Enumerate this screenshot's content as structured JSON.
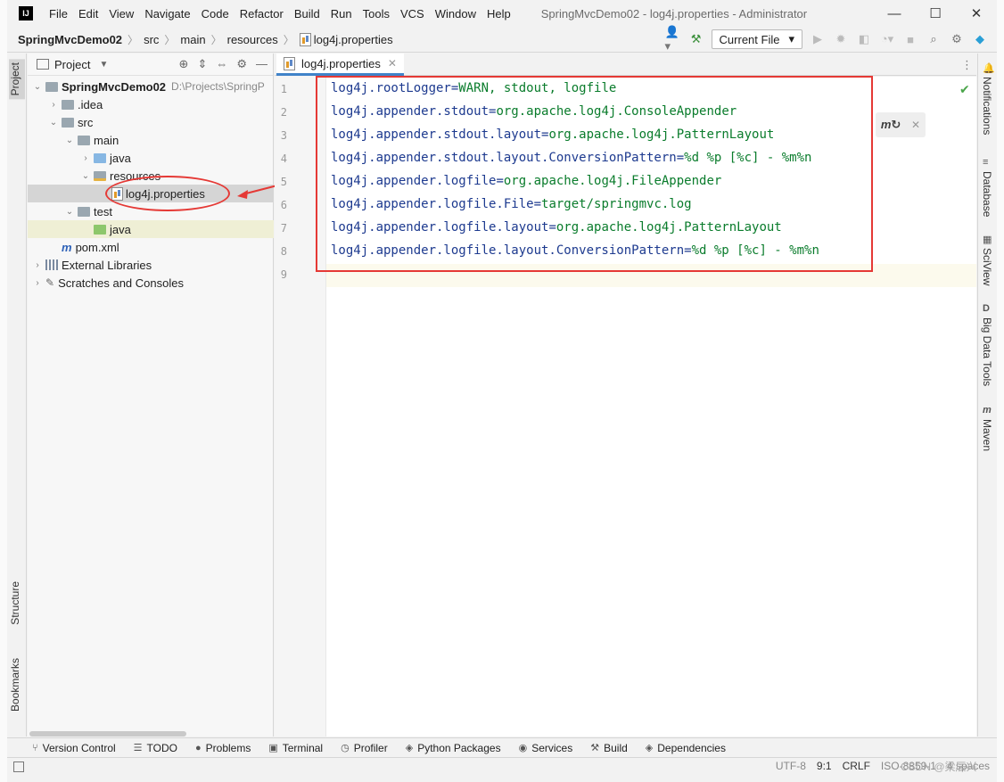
{
  "window": {
    "title": "SpringMvcDemo02 - log4j.properties - Administrator",
    "app_logo": "IJ",
    "controls": [
      "—",
      "☐",
      "✕"
    ]
  },
  "menu": [
    "File",
    "Edit",
    "View",
    "Navigate",
    "Code",
    "Refactor",
    "Build",
    "Run",
    "Tools",
    "VCS",
    "Window",
    "Help"
  ],
  "breadcrumb": {
    "items": [
      "SpringMvcDemo02",
      "src",
      "main",
      "resources",
      "log4j.properties"
    ]
  },
  "toolbar": {
    "run_config": "Current File"
  },
  "left_stripe": {
    "project_tab": "Project",
    "structure_tab": "Structure",
    "bookmarks_tab": "Bookmarks"
  },
  "project_panel": {
    "title": "Project",
    "tree": [
      {
        "label": "SpringMvcDemo02",
        "hint": "D:\\Projects\\SpringP",
        "icon": "folder"
      },
      {
        "label": ".idea",
        "icon": "folder"
      },
      {
        "label": "src",
        "icon": "folder"
      },
      {
        "label": "main",
        "icon": "folder"
      },
      {
        "label": "java",
        "icon": "folder-blue"
      },
      {
        "label": "resources",
        "icon": "folder-resources"
      },
      {
        "label": "log4j.properties",
        "icon": "properties-file"
      },
      {
        "label": "test",
        "icon": "folder"
      },
      {
        "label": "java",
        "icon": "folder-green"
      },
      {
        "label": "pom.xml",
        "icon": "maven-icon"
      },
      {
        "label": "External Libraries",
        "icon": "libraries-icon"
      },
      {
        "label": "Scratches and Consoles",
        "icon": "scratches-icon"
      }
    ]
  },
  "editor": {
    "tab_label": "log4j.properties",
    "line_numbers": [
      "1",
      "2",
      "3",
      "4",
      "5",
      "6",
      "7",
      "8",
      "9"
    ],
    "lines": [
      {
        "key": "log4j.rootLogger",
        "value": "WARN, stdout, logfile"
      },
      {
        "key": "log4j.appender.stdout",
        "value": "org.apache.log4j.ConsoleAppender"
      },
      {
        "key": "log4j.appender.stdout.layout",
        "value": "org.apache.log4j.PatternLayout"
      },
      {
        "key": "log4j.appender.stdout.layout.ConversionPattern",
        "value": "%d %p [%c] - %m%n"
      },
      {
        "key": "log4j.appender.logfile",
        "value": "org.apache.log4j.FileAppender"
      },
      {
        "key": "log4j.appender.logfile.File",
        "value": "target/springmvc.log"
      },
      {
        "key": "log4j.appender.logfile.layout",
        "value": "org.apache.log4j.PatternLayout"
      },
      {
        "key": "log4j.appender.logfile.layout.ConversionPattern",
        "value": "%d %p [%c] - %m%n"
      }
    ],
    "eq": "="
  },
  "right_stripe": [
    "Notifications",
    "Database",
    "SciView",
    "Big Data Tools",
    "Maven"
  ],
  "bottom_tools": [
    "Version Control",
    "TODO",
    "Problems",
    "Terminal",
    "Profiler",
    "Python Packages",
    "Services",
    "Build",
    "Dependencies"
  ],
  "status": {
    "encoding": "UTF-8",
    "position": "9:1",
    "line_sep": "CRLF",
    "file_encoding": "ISO-8859-1",
    "indent": "4 spaces"
  },
  "watermark": "CSDN @梁辰兴",
  "colors": {
    "accent": "#4083c9",
    "annotation": "#e53935",
    "property_key": "#1d3a8f",
    "property_value": "#0a7c2c"
  }
}
